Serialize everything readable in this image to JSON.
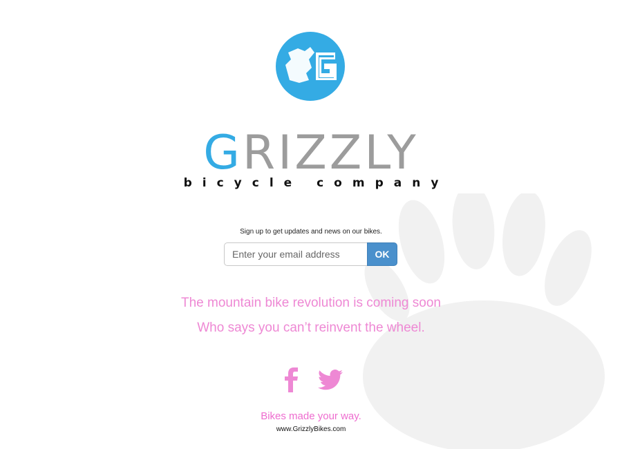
{
  "brand": {
    "wordmark_first": "G",
    "wordmark_rest": "RIZZLY",
    "tagline": "bicycle company",
    "colors": {
      "blue": "#34abe4",
      "gray": "#9c9c9c",
      "pink": "#ee88d4",
      "button": "#4a90cc"
    }
  },
  "signup": {
    "prompt": "Sign up to get updates and news on our bikes.",
    "email_placeholder": "Enter your email address",
    "email_value": "",
    "ok_label": "OK"
  },
  "messages": {
    "line1": "The mountain bike revolution is coming soon",
    "line2": "Who says you can’t reinvent the wheel."
  },
  "social": {
    "icons": [
      "facebook-icon",
      "twitter-icon"
    ]
  },
  "footer": {
    "slogan": "Bikes made your way.",
    "url": "www.GrizzlyBikes.com"
  }
}
